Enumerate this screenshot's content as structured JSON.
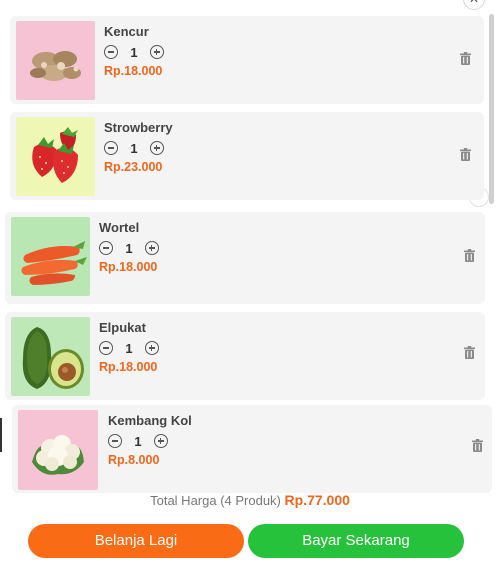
{
  "close_icon": "close-icon",
  "trash_icon": "trash-icon",
  "colors": {
    "accent_orange": "#fa6b15",
    "price_orange": "#f2661b",
    "accent_green": "#26c23b",
    "card_bg": "#f4f4f5"
  },
  "cart": {
    "items": [
      {
        "name": "Kencur",
        "qty": "1",
        "price": "Rp.18.000",
        "image": "ginger-root",
        "thumb_bg": "#f5c3d3"
      },
      {
        "name": "Strowberry",
        "qty": "1",
        "price": "Rp.23.000",
        "image": "strawberry",
        "thumb_bg": "#eef7b4"
      },
      {
        "name": "Wortel",
        "qty": "1",
        "price": "Rp.18.000",
        "image": "carrot",
        "thumb_bg": "#b8e7b4"
      },
      {
        "name": "Elpukat",
        "qty": "1",
        "price": "Rp.18.000",
        "image": "avocado",
        "thumb_bg": "#bfe8b9"
      },
      {
        "name": "Kembang Kol",
        "qty": "1",
        "price": "Rp.8.000",
        "image": "cauliflower",
        "thumb_bg": "#f5c3d3"
      }
    ]
  },
  "summary": {
    "label": "Total Harga (4 Produk)",
    "amount": "Rp.77.000"
  },
  "actions": {
    "continue_label": "Belanja Lagi",
    "pay_label": "Bayar Sekarang"
  }
}
